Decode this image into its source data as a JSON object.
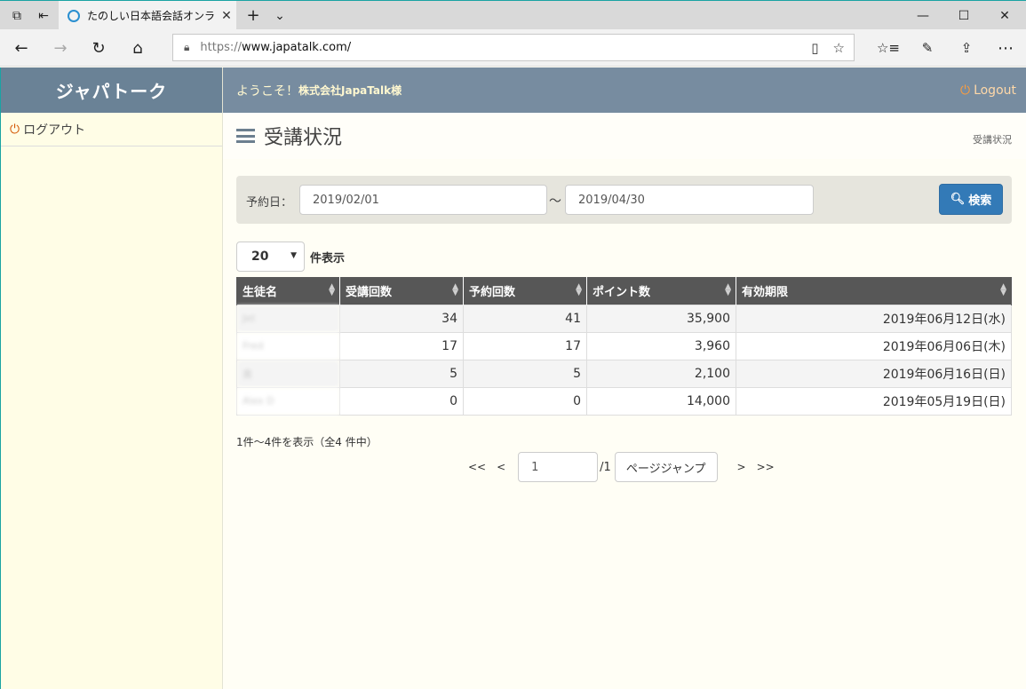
{
  "browser": {
    "tab_title": "たのしい日本語会話オンラ",
    "url_proto": "https://",
    "url_host": "www.japatalk.com/"
  },
  "app": {
    "brand": "ジャパトーク",
    "welcome": "ようこそ！",
    "company": "株式会社JapaTalk様",
    "logout": "Logout"
  },
  "sidebar": {
    "items": [
      {
        "label": "ログアウト"
      }
    ]
  },
  "page": {
    "title": "受講状況",
    "breadcrumb": "受講状況"
  },
  "search": {
    "label": "予約日：",
    "from": "2019/02/01",
    "separator": "～",
    "to": "2019/04/30",
    "button": "検索"
  },
  "per_page": {
    "value": "20",
    "label": "件表示"
  },
  "table": {
    "headers": [
      "生徒名",
      "受講回数",
      "予約回数",
      "ポイント数",
      "有効期限"
    ],
    "rows": [
      {
        "name": "Jet",
        "lessons": "34",
        "reserved": "41",
        "points": "35,900",
        "expiry": "2019年06月12日(水)"
      },
      {
        "name": "Fred",
        "lessons": "17",
        "reserved": "17",
        "points": "3,960",
        "expiry": "2019年06月06日(木)"
      },
      {
        "name": "奥",
        "lessons": "5",
        "reserved": "5",
        "points": "2,100",
        "expiry": "2019年06月16日(日)"
      },
      {
        "name": "Alex D",
        "lessons": "0",
        "reserved": "0",
        "points": "14,000",
        "expiry": "2019年05月19日(日)"
      }
    ]
  },
  "pagination": {
    "info": "1件～4件を表示（全4 件中）",
    "first": "<<",
    "prev": "<",
    "current": "1",
    "total": "/1",
    "jump": "ページジャンプ",
    "next": ">",
    "last": ">>"
  },
  "colors": {
    "header_bg": "#778ca0",
    "brand_bg": "#6a8296",
    "primary": "#337ab7",
    "table_head": "#575757"
  }
}
